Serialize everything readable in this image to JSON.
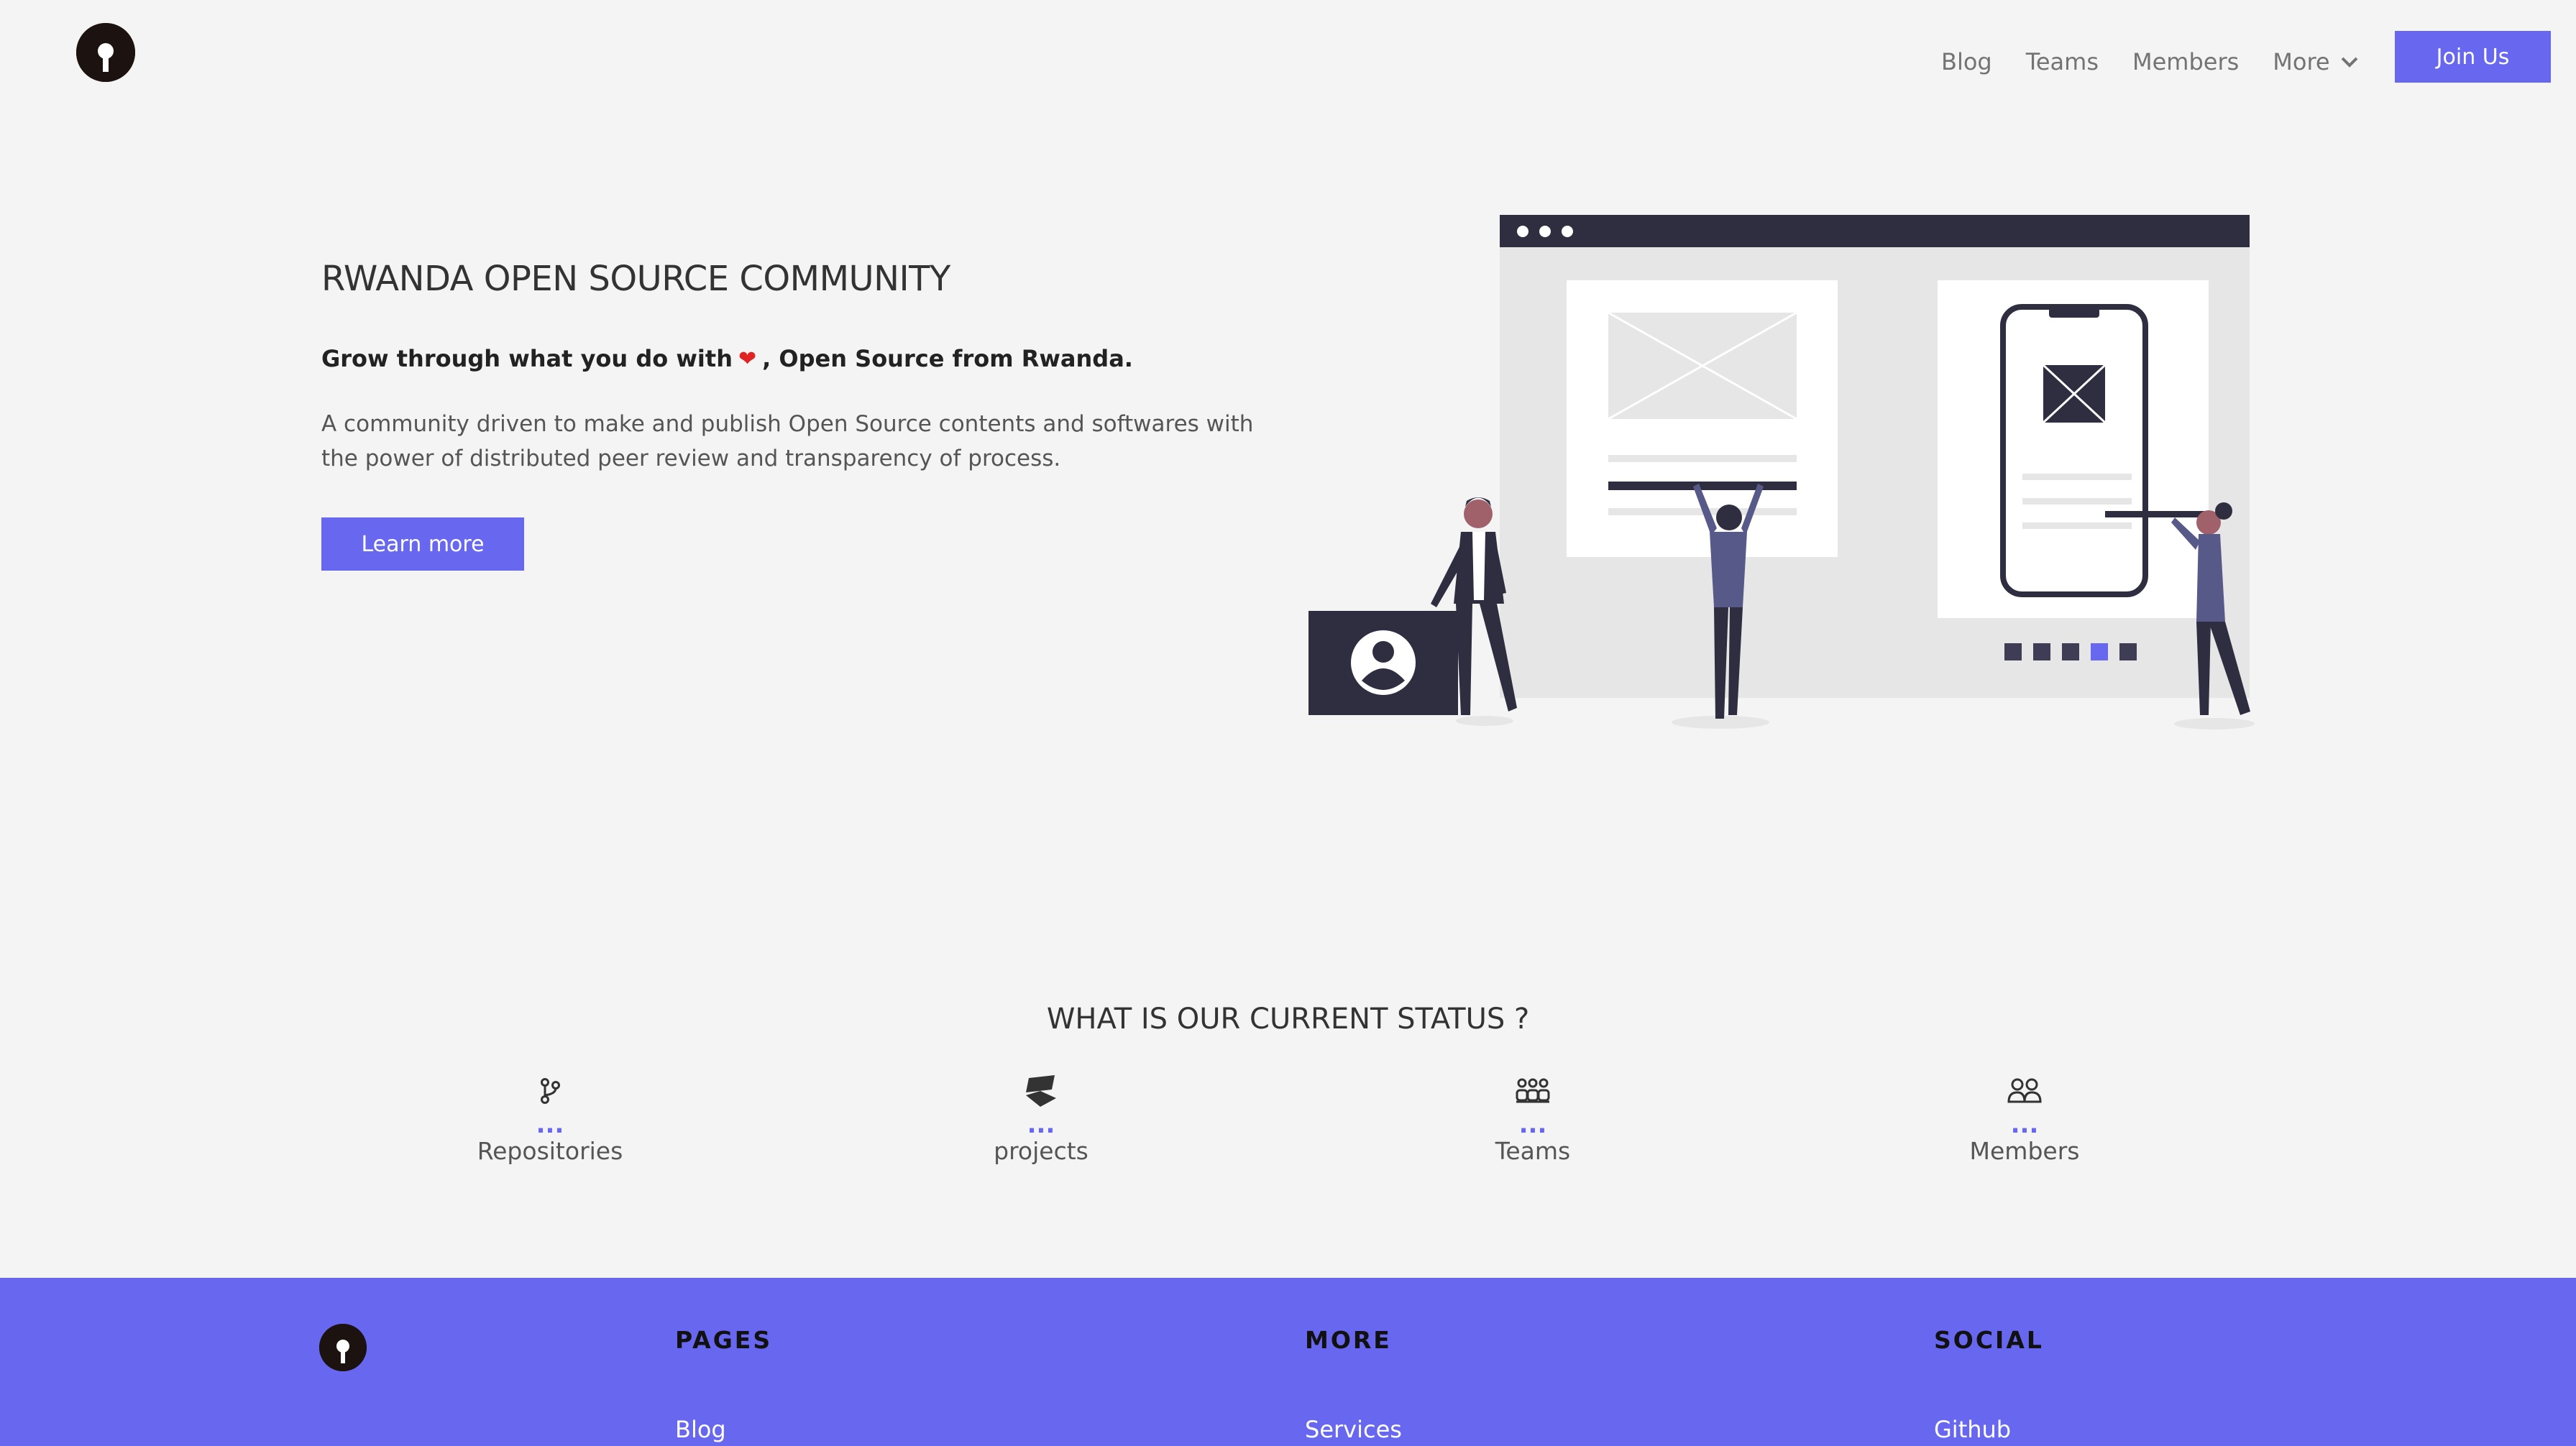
{
  "header": {
    "nav": [
      "Blog",
      "Teams",
      "Members",
      "More"
    ],
    "join_label": "Join Us"
  },
  "hero": {
    "title": "RWANDA OPEN SOURCE COMMUNITY",
    "subtitle_before": "Grow through what you do with",
    "subtitle_after": ", Open Source from Rwanda.",
    "description": "A community driven to make and publish Open Source contents and softwares with the power of distributed peer review and transparency of process.",
    "cta_label": "Learn more"
  },
  "status": {
    "title": "WHAT IS OUR CURRENT STATUS ?",
    "items": [
      {
        "icon": "git-branch-icon",
        "value": "...",
        "label": "Repositories"
      },
      {
        "icon": "layers-icon",
        "value": "...",
        "label": "projects"
      },
      {
        "icon": "team-icon",
        "value": "...",
        "label": "Teams"
      },
      {
        "icon": "users-icon",
        "value": "...",
        "label": "Members"
      }
    ]
  },
  "footer": {
    "pages_heading": "PAGES",
    "more_heading": "MORE",
    "social_heading": "SOCIAL",
    "pages_first": "Blog",
    "more_first": "Services",
    "social_first": "Github"
  },
  "colors": {
    "accent": "#6767f0",
    "background": "#f4f4f4",
    "dark": "#2f2e41"
  }
}
